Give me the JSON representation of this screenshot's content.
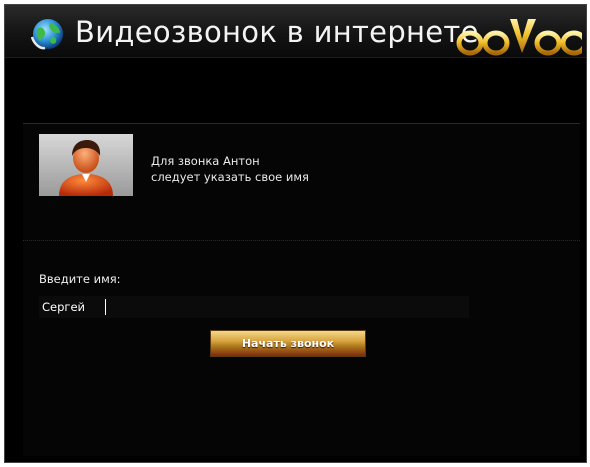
{
  "window": {
    "title": "Видеозвонок в интернете",
    "logo_text": "ooVoo"
  },
  "call": {
    "avatar_icon": "user-avatar-icon",
    "message_line1": "Для звонка Антон",
    "message_line2": "следует указать свое имя"
  },
  "form": {
    "name_label": "Введите имя:",
    "name_value": "Сергей",
    "start_button_label": "Начать звонок"
  },
  "colors": {
    "background": "#000000",
    "button_gold": "#d7a43f",
    "button_dark": "#7d2a0e"
  }
}
